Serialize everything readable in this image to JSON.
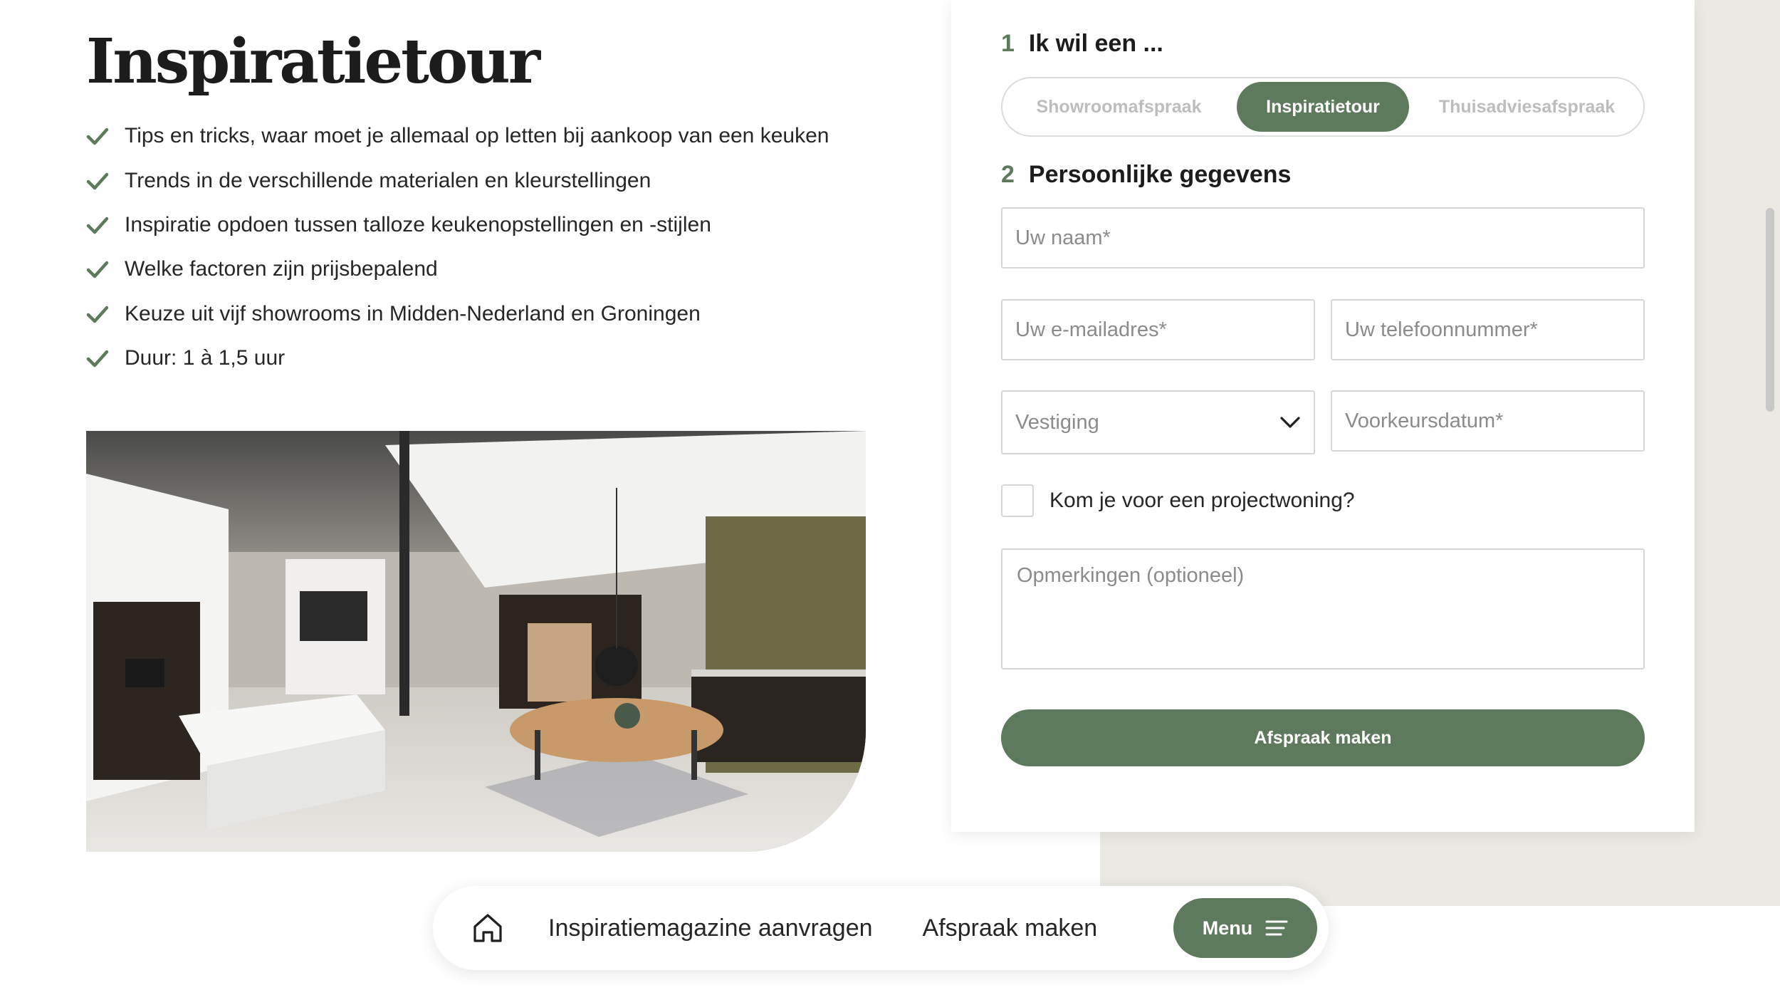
{
  "page": {
    "title": "Inspiratietour",
    "features": [
      "Tips en tricks, waar moet je allemaal op letten bij aankoop van een keuken",
      "Trends in de verschillende materialen en kleurstellingen",
      "Inspiratie opdoen tussen talloze keukenopstellingen en -stijlen",
      "Welke factoren zijn prijsbepalend",
      "Keuze uit vijf showrooms in Midden-Nederland en Groningen",
      "Duur: 1 à 1,5 uur"
    ],
    "photo_icon": "kitchen-showroom-photo"
  },
  "form": {
    "step1": {
      "number": "1",
      "title": "Ik wil een ..."
    },
    "appointment_types": [
      {
        "label": "Showroomafspraak",
        "active": false
      },
      {
        "label": "Inspiratietour",
        "active": true
      },
      {
        "label": "Thuisadviesafspraak",
        "active": false
      }
    ],
    "step2": {
      "number": "2",
      "title": "Persoonlijke gegevens"
    },
    "fields": {
      "name_placeholder": "Uw naam*",
      "email_placeholder": "Uw e-mailadres*",
      "phone_placeholder": "Uw telefoonnummer*",
      "location_select": "Vestiging",
      "date_placeholder": "Voorkeursdatum*",
      "project_checkbox_label": "Kom je voor een projectwoning?",
      "remarks_placeholder": "Opmerkingen (optioneel)"
    },
    "submit_label": "Afspraak maken"
  },
  "bottom_nav": {
    "home_icon": "home-icon",
    "link1": "Inspiratiemagazine aanvragen",
    "link2": "Afspraak maken",
    "menu_label": "Menu",
    "menu_icon": "hamburger-icon"
  },
  "colors": {
    "accent_green": "#5e7a5c",
    "beige": "#ebe9e3"
  }
}
